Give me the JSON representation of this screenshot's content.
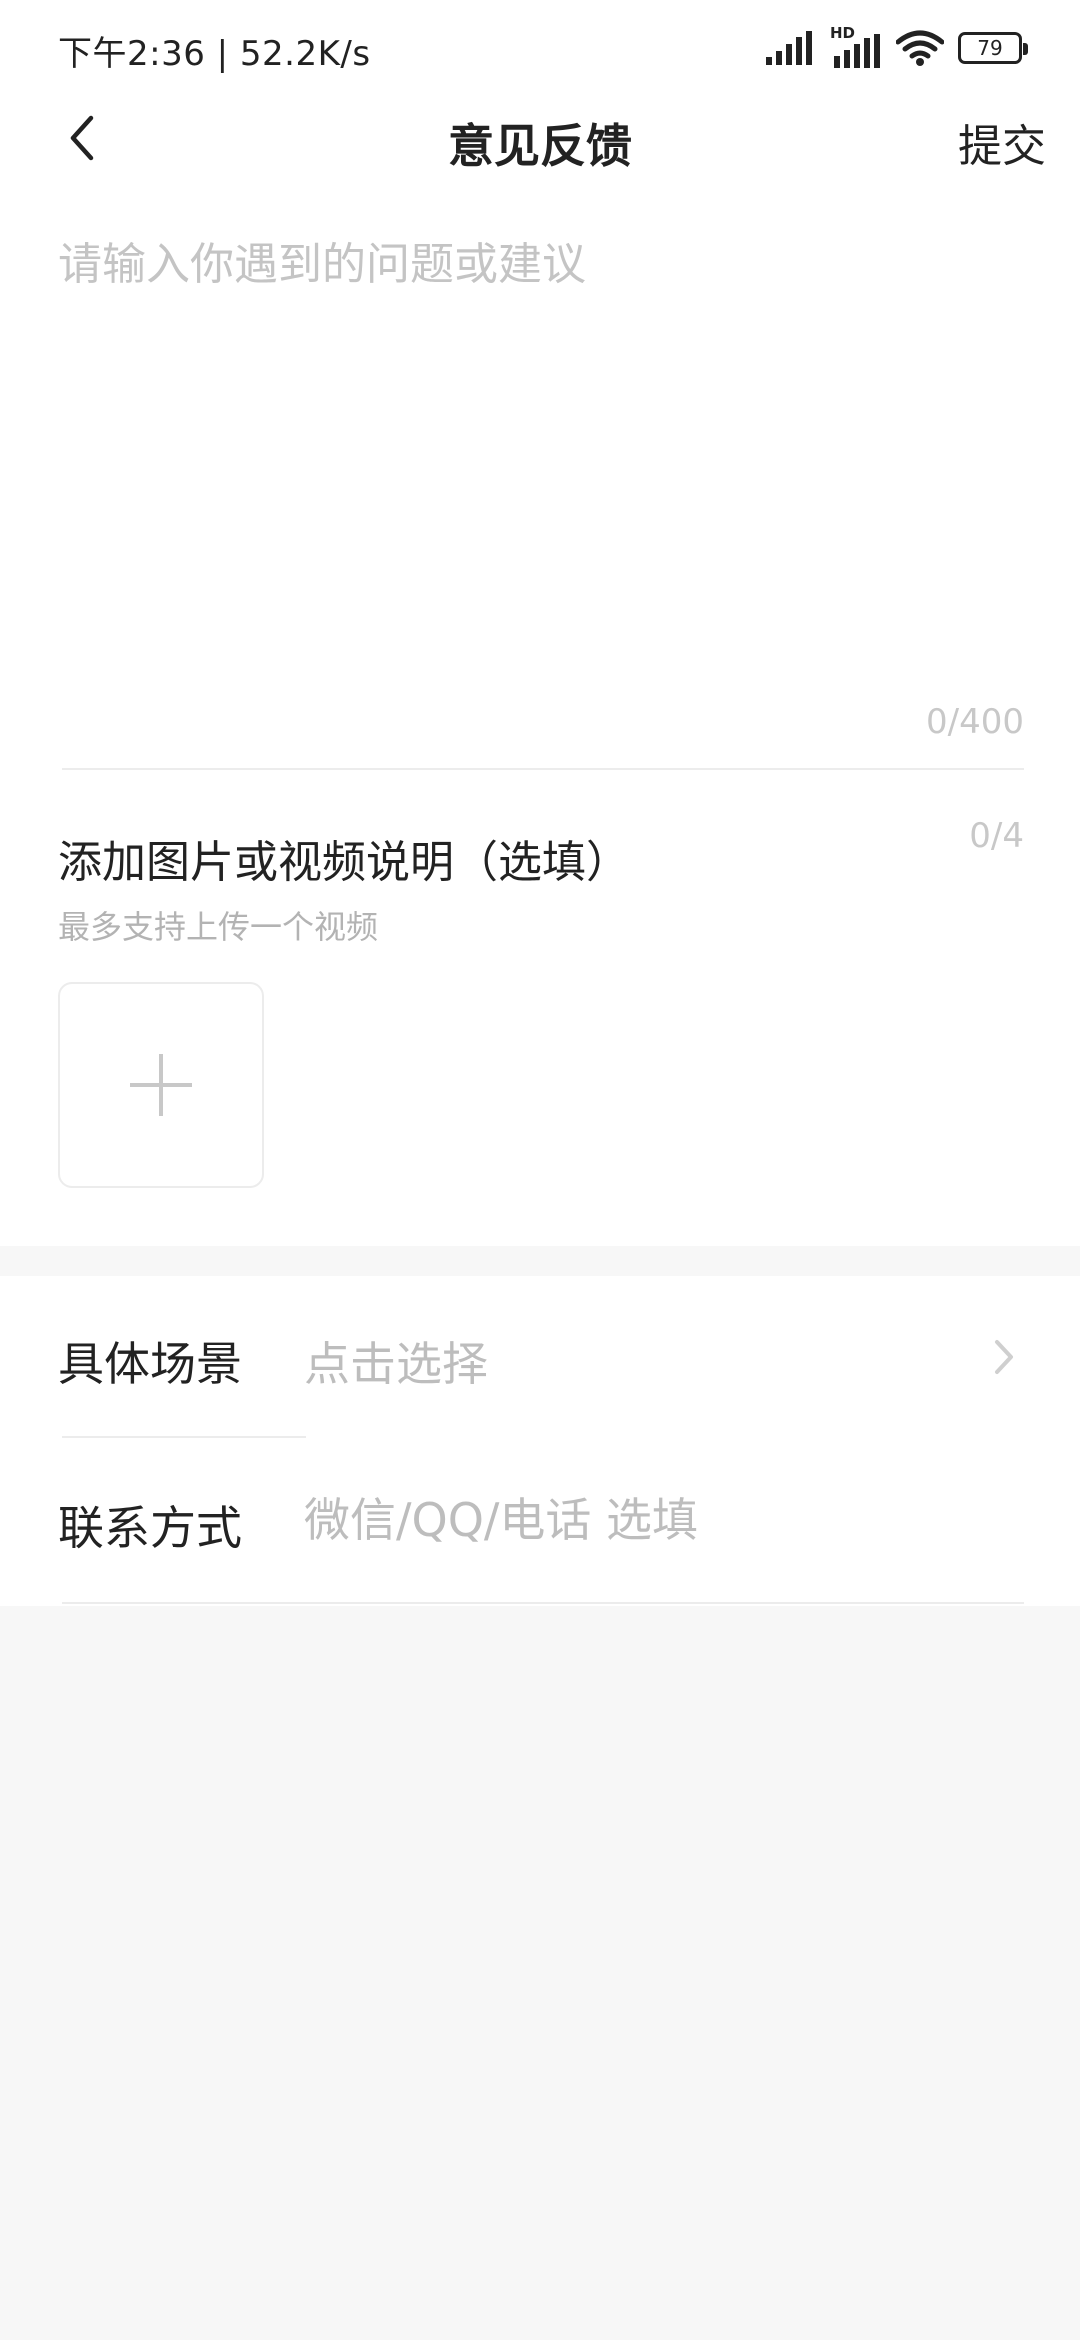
{
  "status_bar": {
    "time_speed": "下午2:36 | 52.2K/s",
    "network_label": "HD",
    "battery_level": "79"
  },
  "header": {
    "title": "意见反馈",
    "submit_label": "提交"
  },
  "feedback": {
    "placeholder": "请输入你遇到的问题或建议",
    "value": "",
    "counter": "0/400"
  },
  "attachments": {
    "title": "添加图片或视频说明（选填）",
    "counter": "0/4",
    "hint": "最多支持上传一个视频"
  },
  "options": {
    "scene_label": "具体场景",
    "scene_value": "点击选择",
    "contact_label": "联系方式",
    "contact_placeholder": "微信/QQ/电话 选填"
  },
  "colors": {
    "background": "#f7f7f7",
    "card": "#ffffff",
    "text_primary": "#222222",
    "text_placeholder": "#c4c4c4",
    "divider": "#ececec"
  },
  "icons": {
    "back": "chevron-left-icon",
    "add": "plus-icon",
    "scene_arrow": "chevron-right-icon",
    "signal": "signal-icon",
    "wifi": "wifi-icon",
    "battery": "battery-icon"
  }
}
